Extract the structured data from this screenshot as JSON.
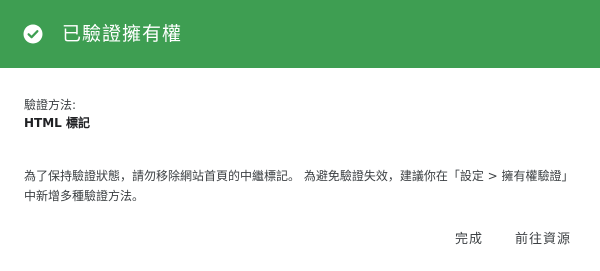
{
  "colors": {
    "header_bg": "#3e9e52",
    "header_text": "#ffffff",
    "body_text": "#3c4043"
  },
  "header": {
    "icon": "check-circle-icon",
    "title": "已驗證擁有權"
  },
  "body": {
    "method_label": "驗證方法:",
    "method_value": "HTML 標記",
    "notice": "為了保持驗證狀態，請勿移除網站首頁的中繼標記。 為避免驗證失效，建議你在「設定 > 擁有權驗證」中新增多種驗證方法。"
  },
  "actions": {
    "done_label": "完成",
    "go_to_property_label": "前往資源"
  }
}
